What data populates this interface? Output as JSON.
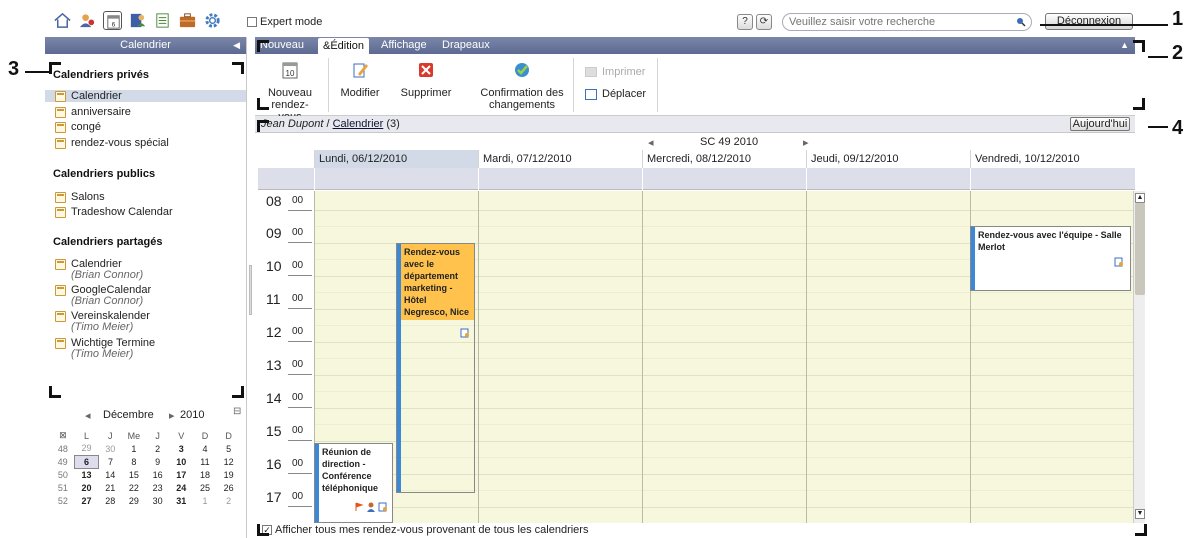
{
  "toolbar": {
    "icons": [
      "home-icon",
      "users-icon",
      "calendar-icon",
      "contacts-icon",
      "tasks-icon",
      "briefcase-icon",
      "gear-icon"
    ],
    "expert_mode_label": "Expert mode",
    "search_placeholder": "Veuillez saisir votre recherche",
    "help_label": "?",
    "refresh_label": "⟳",
    "logout_label": "Déconnexion"
  },
  "sidebar": {
    "title": "Calendrier",
    "private_title": "Calendriers privés",
    "private": [
      {
        "label": "Calendrier"
      },
      {
        "label": "anniversaire"
      },
      {
        "label": "congé"
      },
      {
        "label": "rendez-vous spécial"
      }
    ],
    "public_title": "Calendriers publics",
    "public": [
      {
        "label": "Salons"
      },
      {
        "label": "Tradeshow Calendar"
      }
    ],
    "shared_title": "Calendriers partagés",
    "shared": [
      {
        "label": "Calendrier",
        "owner": "(Brian Connor)"
      },
      {
        "label": "GoogleCalendar",
        "owner": "(Brian Connor)"
      },
      {
        "label": "Vereinskalender",
        "owner": "(Timo Meier)"
      },
      {
        "label": "Wichtige Termine",
        "owner": "(Timo Meier)"
      }
    ]
  },
  "minical": {
    "month": "Décembre",
    "year": "2010",
    "headers": [
      "L",
      "J",
      "Me",
      "J",
      "V",
      "D",
      "D"
    ],
    "weeks": [
      {
        "wk": "48",
        "days": [
          "29",
          "30",
          "1",
          "2",
          "3",
          "4",
          "5"
        ]
      },
      {
        "wk": "49",
        "days": [
          "6",
          "7",
          "8",
          "9",
          "10",
          "11",
          "12"
        ]
      },
      {
        "wk": "50",
        "days": [
          "13",
          "14",
          "15",
          "16",
          "17",
          "18",
          "19"
        ]
      },
      {
        "wk": "51",
        "days": [
          "20",
          "21",
          "22",
          "23",
          "24",
          "25",
          "26"
        ]
      },
      {
        "wk": "52",
        "days": [
          "27",
          "28",
          "29",
          "30",
          "31",
          "1",
          "2"
        ]
      }
    ]
  },
  "tabs": [
    "Nouveau",
    "&Édition",
    "Affichage",
    "Drapeaux"
  ],
  "ribbon": {
    "new_appt": "Nouveau rendez-vous",
    "new_appt_l1": "Nouveau",
    "new_appt_l2": "rendez-vous",
    "modify": "Modifier",
    "delete": "Supprimer",
    "confirm_l1": "Confirmation des",
    "confirm_l2": "changements",
    "print": "Imprimer",
    "move": "Déplacer"
  },
  "breadcrumb": {
    "user": "Jean Dupont",
    "sep": " / ",
    "calendar": "Calendrier",
    "count": " (3)"
  },
  "today_label": "Aujourd'hui",
  "week_label": "SC 49 2010",
  "days": [
    "Lundi, 06/12/2010",
    "Mardi, 07/12/2010",
    "Mercredi, 08/12/2010",
    "Jeudi, 09/12/2010",
    "Vendredi, 10/12/2010"
  ],
  "hours": [
    "08",
    "09",
    "10",
    "11",
    "12",
    "13",
    "14",
    "15",
    "16",
    "17"
  ],
  "minutes": "00",
  "appointments": [
    {
      "title": "Rendez-vous avec le département marketing - Hôtel Negresco, Nice",
      "color": "#ffc34d"
    },
    {
      "title": "Réunion de direction - Conférence téléphonique",
      "color": "#ffffff"
    },
    {
      "title": "Rendez-vous avec l'équipe - Salle Merlot",
      "color": "#ffffff"
    }
  ],
  "footer_label": "Afficher tous mes rendez-vous provenant de tous les calendriers",
  "callouts": [
    "1",
    "2",
    "3",
    "4"
  ],
  "colors": {
    "accent": "#5d6a91",
    "selection": "#d3dae7",
    "grid_bg": "#f6f7dc",
    "appt_bar": "#3b87d8"
  }
}
